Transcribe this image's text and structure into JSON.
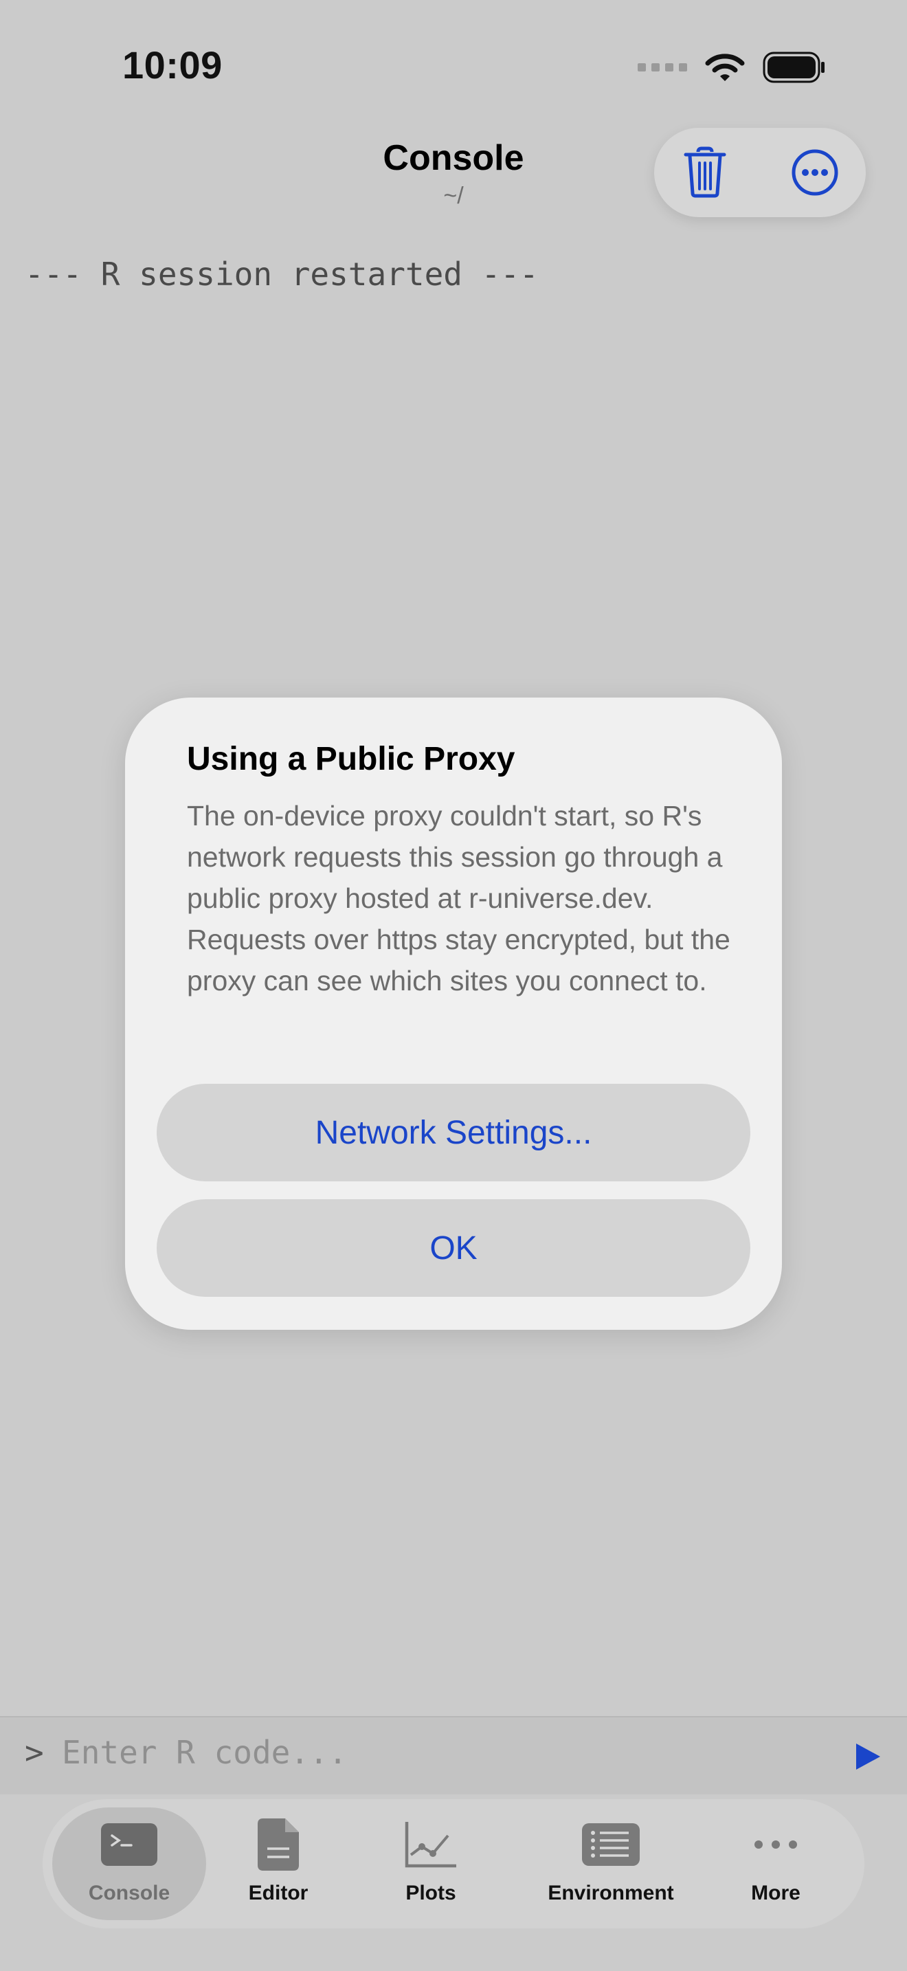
{
  "status_bar": {
    "time": "10:09"
  },
  "header": {
    "title": "Console",
    "subtitle": "~/"
  },
  "console": {
    "output": "--- R session restarted ---"
  },
  "alert": {
    "title": "Using a Public Proxy",
    "message": "The on-device proxy couldn't start, so R's network requests this session go through a public proxy hosted at r-universe.dev. Requests over https stay encrypted, but the proxy can see which sites you connect to.",
    "buttons": {
      "network_settings": "Network Settings...",
      "ok": "OK"
    }
  },
  "input_bar": {
    "prompt": ">",
    "placeholder": "Enter R code..."
  },
  "tabs": [
    {
      "label": "Console",
      "icon": "terminal-icon",
      "active": true
    },
    {
      "label": "Editor",
      "icon": "document-icon",
      "active": false
    },
    {
      "label": "Plots",
      "icon": "line-chart-icon",
      "active": false
    },
    {
      "label": "Environment",
      "icon": "list-icon",
      "active": false
    },
    {
      "label": "More",
      "icon": "ellipsis-icon",
      "active": false
    }
  ],
  "colors": {
    "accent": "#1a45c9",
    "background": "#cbcbcb",
    "alert_background": "#f0f0f0"
  }
}
